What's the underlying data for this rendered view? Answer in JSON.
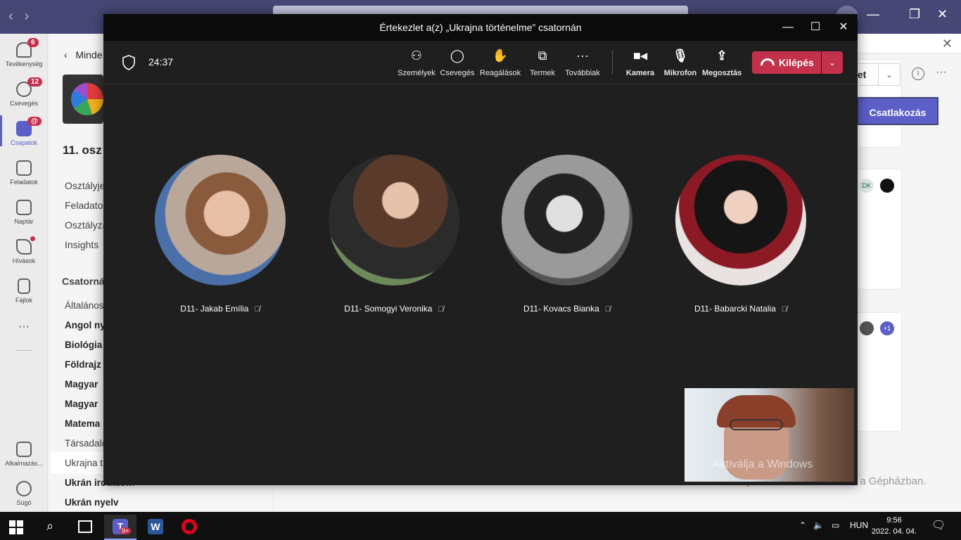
{
  "teams": {
    "rail": [
      {
        "label": "Tevékenység",
        "badge": "6",
        "icon": "bell-icon"
      },
      {
        "label": "Csevegés",
        "badge": "12",
        "icon": "chat-icon"
      },
      {
        "label": "Csapatok",
        "badge": "@",
        "icon": "teams-icon",
        "active": true
      },
      {
        "label": "Feladatok",
        "icon": "backpack-icon"
      },
      {
        "label": "Naptár",
        "icon": "calendar-icon"
      },
      {
        "label": "Hívások",
        "icon": "phone-icon"
      },
      {
        "label": "Fájlok",
        "icon": "file-icon"
      },
      {
        "label": "Alkalmazás...",
        "icon": "apps-icon"
      },
      {
        "label": "Súgó",
        "icon": "help-icon"
      }
    ],
    "more_dots": "···",
    "sidepanel": {
      "back_label": "Minde",
      "team_name": "11. osz",
      "links": [
        "Osztályje",
        "Feladatok",
        "Osztályza",
        "Insights"
      ],
      "channels_heading": "Csatorná",
      "channels": [
        {
          "label": "Általános",
          "bold": false
        },
        {
          "label": "Angol ny",
          "bold": true
        },
        {
          "label": "Biológia",
          "bold": true
        },
        {
          "label": "Földrajz",
          "bold": true
        },
        {
          "label": "Magyar",
          "bold": true
        },
        {
          "label": "Magyar",
          "bold": true
        },
        {
          "label": "Matema",
          "bold": true
        },
        {
          "label": "Társadalo",
          "bold": false
        },
        {
          "label": "Ukrajna t",
          "bold": false,
          "active": true
        },
        {
          "label": "Ukrán irodalom",
          "bold": true
        },
        {
          "label": "Ukrán nyelv",
          "bold": true
        }
      ]
    },
    "main": {
      "meet_button": "let",
      "join_button": "Csatlakozás",
      "avatar_initials": "DK",
      "plus_count": "+1",
      "watermark_line1": "Aktiválja a Windows",
      "watermark_line2": "Aktiválja a Windows rendszert a Gépházban."
    }
  },
  "meeting": {
    "window_title": "Értekezlet a(z) „Ukrajna történelme” csatornán",
    "timer": "24:37",
    "toolbar": [
      {
        "label": "Személyek",
        "icon": "people-icon"
      },
      {
        "label": "Csevegés",
        "icon": "chat-icon"
      },
      {
        "label": "Reagálások",
        "icon": "reaction-icon"
      },
      {
        "label": "Termek",
        "icon": "rooms-icon"
      },
      {
        "label": "Továbbiak",
        "icon": "more-icon"
      },
      {
        "label": "Kamera",
        "icon": "camera-icon"
      },
      {
        "label": "Mikrofon",
        "icon": "microphone-icon"
      },
      {
        "label": "Megosztás",
        "icon": "share-icon"
      }
    ],
    "leave_label": "Kilépés",
    "participants": [
      {
        "name": "D11- Jakab Emília",
        "muted": true
      },
      {
        "name": "D11- Somogyi Veronika",
        "muted": true
      },
      {
        "name": "D11- Kovacs Bianka",
        "muted": true
      },
      {
        "name": "D11- Babarcki Natalia",
        "muted": true
      }
    ]
  },
  "taskbar": {
    "language": "HUN",
    "time": "9:56",
    "date": "2022. 04. 04.",
    "teams_badge": "9+"
  }
}
